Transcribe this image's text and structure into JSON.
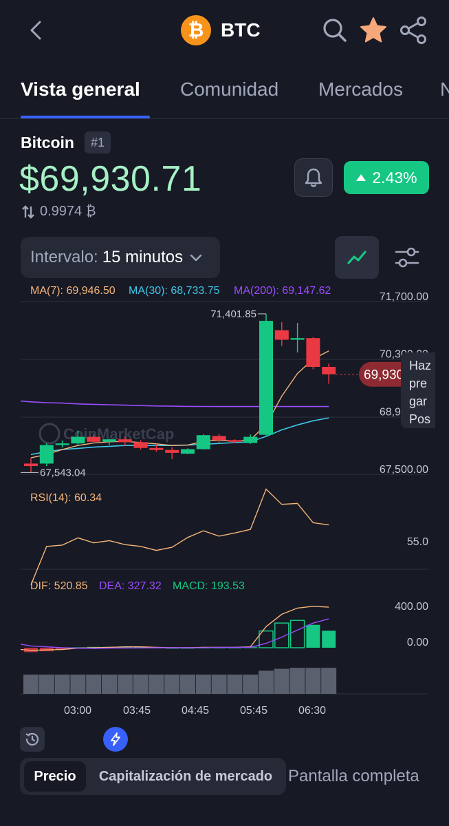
{
  "header": {
    "coin_letter": "₿",
    "coin_symbol": "BTC",
    "icons": [
      "back-icon",
      "search-icon",
      "star-icon",
      "share-icon"
    ]
  },
  "tabs": [
    {
      "label": "Vista general",
      "active": true
    },
    {
      "label": "Comunidad",
      "active": false
    },
    {
      "label": "Mercados",
      "active": false
    },
    {
      "label": "N",
      "active": false
    }
  ],
  "coin": {
    "name": "Bitcoin",
    "rank": "#1",
    "price": "$69,930.71",
    "btc_value": "0.9974 ₿",
    "change": "2.43%"
  },
  "controls": {
    "interval_label": "Intervalo:",
    "interval_value": "15 minutos"
  },
  "colors": {
    "up": "#16c784",
    "down": "#ea3943",
    "ma7": "#f5b57a",
    "ma30": "#3fc6e8",
    "ma200": "#9b4dff",
    "accent": "#3861fb"
  },
  "chart_data": {
    "type": "candlestick",
    "indicators": {
      "ma7": "MA(7): 69,946.50",
      "ma30": "MA(30): 68,733.75",
      "ma200": "MA(200): 69,147.62",
      "rsi": "RSI(14): 60.34",
      "dif": "DIF: 520.85",
      "dea": "DEA: 327.32",
      "macd": "MACD: 193.53"
    },
    "y_ticks": [
      "71,700.00",
      "70,300.00",
      "68,900.00",
      "67,500.00"
    ],
    "y_tick_values": [
      71700,
      70300,
      68900,
      67500
    ],
    "rsi_tick": "55.0",
    "macd_ticks": [
      "400.00",
      "0.00"
    ],
    "x_ticks": [
      "03:00",
      "03:45",
      "04:45",
      "05:45",
      "06:30"
    ],
    "high_label": "71,401.85",
    "low_label": "67,543.04",
    "current_price_label": "69,930.71",
    "current_price": 69930.71,
    "watermark": "CoinMarketCap",
    "candles": [
      {
        "o": 67760,
        "h": 67900,
        "l": 67543,
        "c": 67700
      },
      {
        "o": 67760,
        "h": 68250,
        "l": 67700,
        "c": 68210
      },
      {
        "o": 68210,
        "h": 68320,
        "l": 68150,
        "c": 68250
      },
      {
        "o": 68250,
        "h": 68560,
        "l": 68200,
        "c": 68410
      },
      {
        "o": 68410,
        "h": 68470,
        "l": 68250,
        "c": 68290
      },
      {
        "o": 68290,
        "h": 68360,
        "l": 68220,
        "c": 68350
      },
      {
        "o": 68350,
        "h": 68420,
        "l": 68180,
        "c": 68280
      },
      {
        "o": 68280,
        "h": 68330,
        "l": 68100,
        "c": 68140
      },
      {
        "o": 68140,
        "h": 68220,
        "l": 68050,
        "c": 68090
      },
      {
        "o": 68090,
        "h": 68160,
        "l": 67870,
        "c": 68020
      },
      {
        "o": 68000,
        "h": 68130,
        "l": 67990,
        "c": 68110
      },
      {
        "o": 68110,
        "h": 68470,
        "l": 68100,
        "c": 68450
      },
      {
        "o": 68430,
        "h": 68480,
        "l": 68250,
        "c": 68330
      },
      {
        "o": 68330,
        "h": 68350,
        "l": 68260,
        "c": 68290
      },
      {
        "o": 68260,
        "h": 68470,
        "l": 68240,
        "c": 68410
      },
      {
        "o": 68460,
        "h": 71400,
        "l": 68440,
        "c": 71230
      },
      {
        "o": 71000,
        "h": 71200,
        "l": 70620,
        "c": 70770
      },
      {
        "o": 70770,
        "h": 71180,
        "l": 70460,
        "c": 70810
      },
      {
        "o": 70810,
        "h": 70830,
        "l": 70050,
        "c": 70110
      },
      {
        "o": 70110,
        "h": 70190,
        "l": 69700,
        "c": 69930
      }
    ],
    "ma7": [
      67900,
      67980,
      68100,
      68200,
      68260,
      68290,
      68300,
      68270,
      68240,
      68200,
      68210,
      68300,
      68330,
      68300,
      68340,
      68700,
      69400,
      69950,
      70300,
      70500
    ],
    "ma30": [
      67980,
      68050,
      68100,
      68130,
      68160,
      68180,
      68200,
      68200,
      68200,
      68200,
      68210,
      68230,
      68250,
      68270,
      68290,
      68420,
      68580,
      68700,
      68800,
      68870
    ],
    "ma200": [
      69260,
      69240,
      69230,
      69210,
      69200,
      69190,
      69180,
      69170,
      69160,
      69155,
      69150,
      69148,
      69147,
      69147,
      69147,
      69147,
      69147,
      69147,
      69147,
      69147
    ],
    "rsi": [
      45.2,
      53.8,
      54.1,
      55.7,
      54.6,
      55.1,
      54.2,
      53.8,
      52.9,
      53.6,
      55.8,
      57.3,
      56.1,
      56.8,
      57.6,
      66.6,
      63.2,
      63.4,
      59.1,
      58.6
    ],
    "dif": [
      -30,
      -25,
      -20,
      -5,
      0,
      5,
      10,
      10,
      5,
      0,
      0,
      5,
      5,
      5,
      10,
      240,
      380,
      450,
      470,
      460
    ],
    "dea": [
      20,
      10,
      0,
      -5,
      -8,
      -5,
      -3,
      -2,
      0,
      0,
      0,
      1,
      3,
      4,
      5,
      50,
      120,
      200,
      280,
      327
    ],
    "macd": [
      -50,
      -40,
      -20,
      5,
      10,
      10,
      12,
      12,
      8,
      5,
      5,
      8,
      8,
      8,
      10,
      190,
      280,
      310,
      260,
      193
    ],
    "volume": [
      1,
      1,
      1,
      1,
      1,
      1,
      1,
      1,
      1,
      1,
      1,
      1,
      1,
      1,
      1,
      1.2,
      1.3,
      1.35,
      1.35,
      1.35
    ]
  },
  "tooltip_text": [
    "Haz",
    "pre",
    "gar",
    "Pos"
  ],
  "bottom": {
    "segments": [
      {
        "label": "Precio",
        "active": true
      },
      {
        "label": "Capitalización de mercado",
        "active": false
      }
    ],
    "fullscreen_label": "Pantalla completa"
  }
}
